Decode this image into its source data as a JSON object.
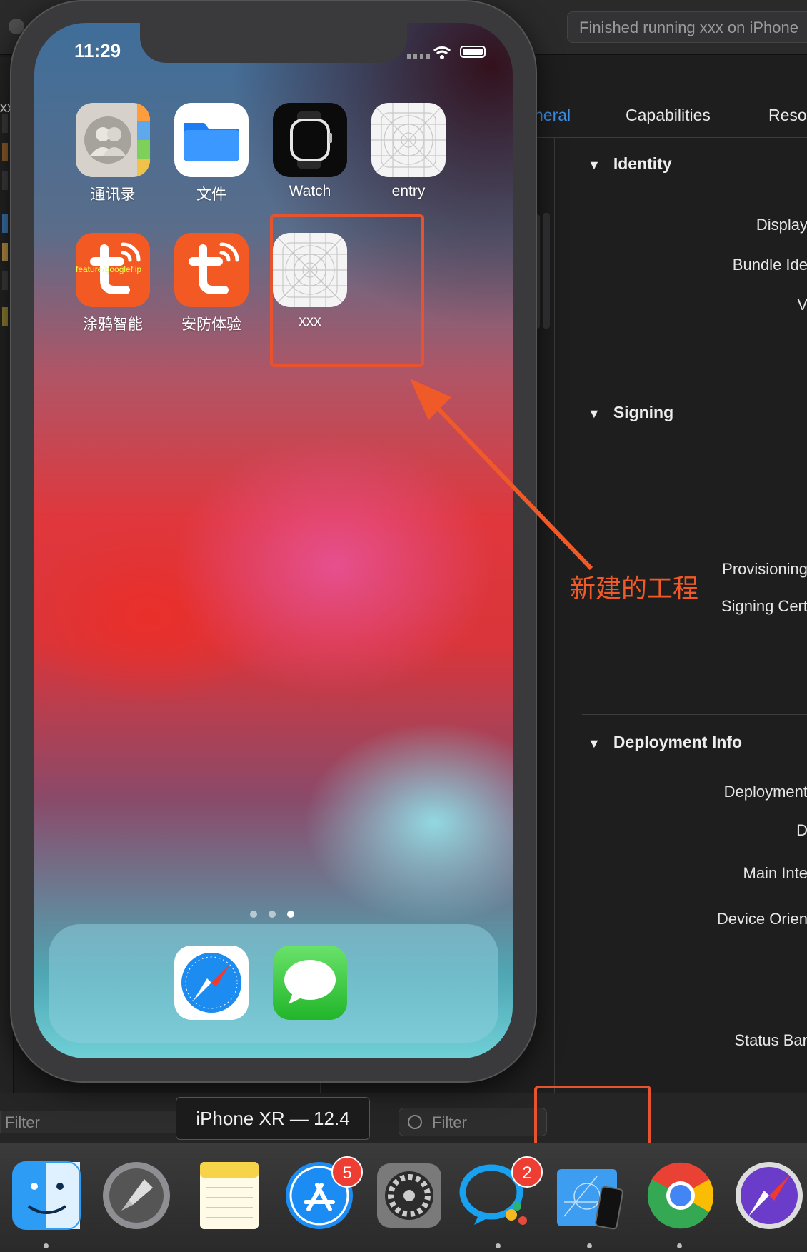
{
  "xcode": {
    "run_status": "Finished running xxx on iPhone",
    "left_label": "xx",
    "tabs": [
      {
        "label": "neral",
        "active": true
      },
      {
        "label": "Capabilities",
        "active": false
      },
      {
        "label": "Reso",
        "active": false
      }
    ],
    "sections": [
      {
        "title": "Identity",
        "fields": [
          "Display",
          "Bundle Ide",
          "V"
        ]
      },
      {
        "title": "Signing",
        "fields": [
          "Provisioning",
          "Signing Cert"
        ]
      },
      {
        "title": "Deployment Info",
        "fields": [
          "Deployment",
          "D",
          "Main Inte",
          "Device Orien",
          "Status Bar"
        ]
      }
    ],
    "filter_left_placeholder": "Filter",
    "filter_right_placeholder": "Filter",
    "device_label": "iPhone XR — 12.4",
    "accent": "#3d8fe8"
  },
  "simulator": {
    "time": "11:29",
    "apps": [
      {
        "label": "通讯录",
        "icon": "contacts-icon"
      },
      {
        "label": "文件",
        "icon": "files-icon"
      },
      {
        "label": "Watch",
        "icon": "watch-icon"
      },
      {
        "label": "entry",
        "icon": "placeholder-app-icon"
      },
      {
        "label": "涂鸦智能",
        "icon": "tuya-icon",
        "overlay": "feature/googleflip"
      },
      {
        "label": "安防体验",
        "icon": "tuya-security-icon"
      },
      {
        "label": "xxx",
        "icon": "placeholder-app-icon"
      }
    ],
    "dock_apps": [
      "safari-icon",
      "messages-icon"
    ],
    "page_count": 3,
    "current_page": 3
  },
  "annotation": {
    "text": "新建的工程",
    "color": "#f05a28"
  },
  "mac_dock": {
    "apps": [
      {
        "name": "finder-icon",
        "badge": null,
        "running": true
      },
      {
        "name": "launchpad-icon",
        "badge": null,
        "running": false
      },
      {
        "name": "notes-icon",
        "badge": null,
        "running": false
      },
      {
        "name": "app-store-icon",
        "badge": "5",
        "running": false
      },
      {
        "name": "system-preferences-icon",
        "badge": null,
        "running": false
      },
      {
        "name": "chat-icon",
        "badge": "2",
        "running": true
      },
      {
        "name": "xcode-simulator-icon",
        "badge": null,
        "running": true
      },
      {
        "name": "chrome-icon",
        "badge": null,
        "running": true
      },
      {
        "name": "safari-technology-preview-icon",
        "badge": null,
        "running": false
      }
    ]
  }
}
